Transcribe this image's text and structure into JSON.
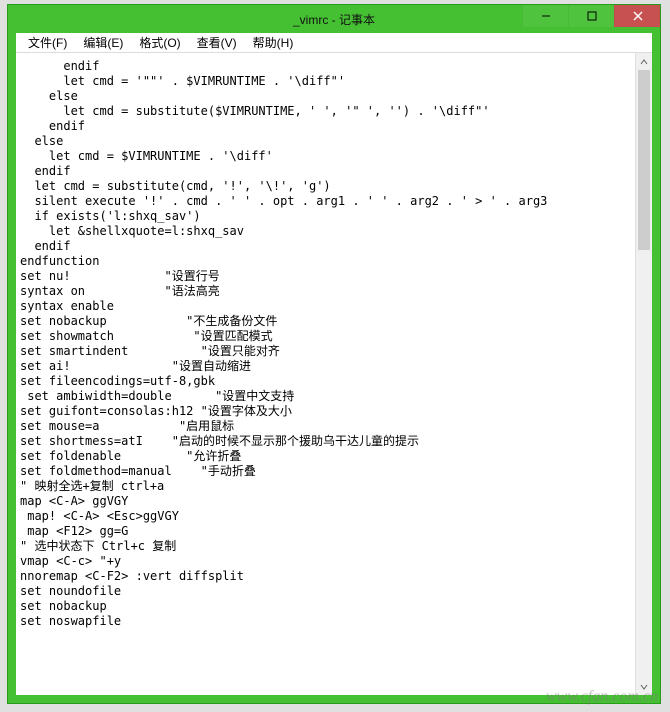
{
  "window": {
    "title": "_vimrc - 记事本"
  },
  "menubar": {
    "items": [
      {
        "label": "文件(F)"
      },
      {
        "label": "编辑(E)"
      },
      {
        "label": "格式(O)"
      },
      {
        "label": "查看(V)"
      },
      {
        "label": "帮助(H)"
      }
    ]
  },
  "content": {
    "text": "      endif\n      let cmd = '\"\"' . $VIMRUNTIME . '\\diff\"'\n    else\n      let cmd = substitute($VIMRUNTIME, ' ', '\" ', '') . '\\diff\"'\n    endif\n  else\n    let cmd = $VIMRUNTIME . '\\diff'\n  endif\n  let cmd = substitute(cmd, '!', '\\!', 'g')\n  silent execute '!' . cmd . ' ' . opt . arg1 . ' ' . arg2 . ' > ' . arg3\n  if exists('l:shxq_sav')\n    let &shellxquote=l:shxq_sav\n  endif\nendfunction\nset nu!             \"设置行号\nsyntax on           \"语法高亮\nsyntax enable\nset nobackup           \"不生成备份文件\nset showmatch           \"设置匹配模式\nset smartindent          \"设置只能对齐\nset ai!              \"设置自动缩进\nset fileencodings=utf-8,gbk\n set ambiwidth=double      \"设置中文支持\nset guifont=consolas:h12 \"设置字体及大小\nset mouse=a           \"启用鼠标\nset shortmess=atI    \"启动的时候不显示那个援助乌干达儿童的提示\nset foldenable         \"允许折叠\nset foldmethod=manual    \"手动折叠\n\" 映射全选+复制 ctrl+a\nmap <C-A> ggVGY\n map! <C-A> <Esc>ggVGY\n map <F12> gg=G\n\" 选中状态下 Ctrl+c 复制\nvmap <C-c> \"+y\nnnoremap <C-F2> :vert diffsplit\nset noundofile\nset nobackup\nset noswapfile"
  },
  "watermark": "www.cfan.com.cn"
}
